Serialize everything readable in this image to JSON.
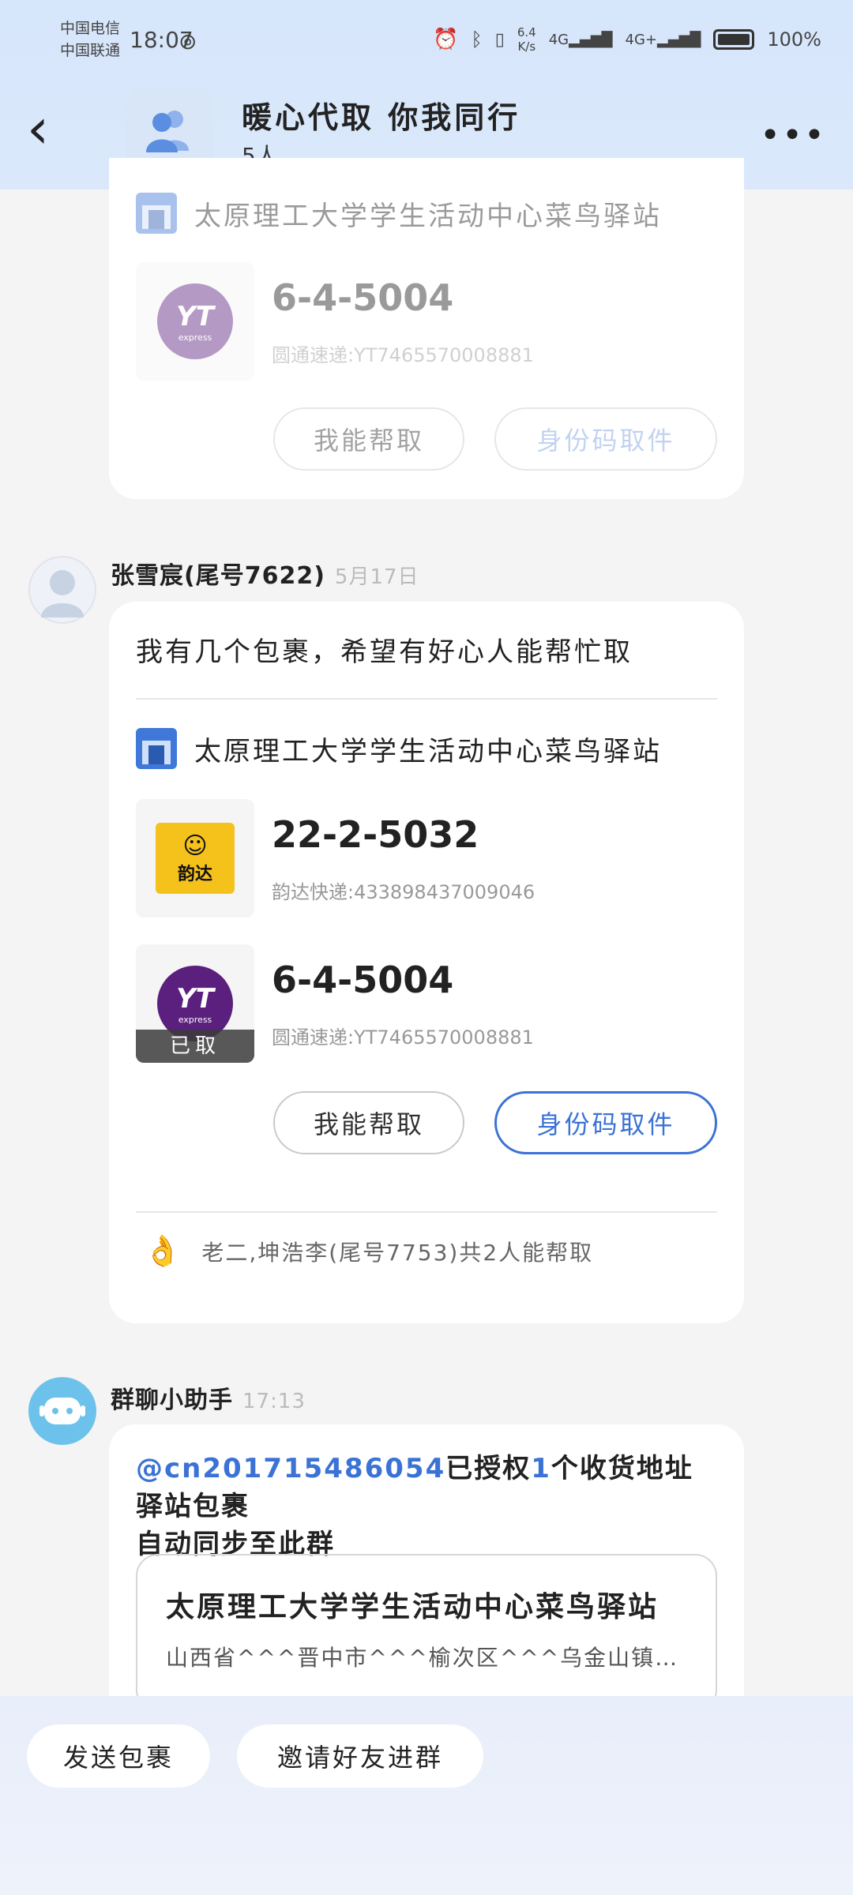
{
  "status_bar": {
    "carrier1": "中国电信",
    "carrier2": "中国联通",
    "time": "18:07",
    "speed_value": "6.4",
    "speed_unit": "K/s",
    "net1": "4G",
    "net2": "4G+",
    "battery": "100%"
  },
  "header": {
    "title": "暖心代取 你我同行",
    "member_count": "5人"
  },
  "message1": {
    "station": "太原理工大学学生活动中心菜鸟驿站",
    "package": {
      "code": "6-4-5004",
      "tracking": "圆通速递:YT7465570008881",
      "logo": "YTO express"
    },
    "help_button": "我能帮取",
    "id_button": "身份码取件"
  },
  "message2": {
    "sender": "张雪宸(尾号7622)",
    "time": "5月17日",
    "text": "我有几个包裹，希望有好心人能帮忙取",
    "station": "太原理工大学学生活动中心菜鸟驿站",
    "packages": [
      {
        "code": "22-2-5032",
        "tracking": "韵达快递:433898437009046",
        "logo": "韵达",
        "picked": ""
      },
      {
        "code": "6-4-5004",
        "tracking": "圆通速递:YT7465570008881",
        "logo": "YTO express",
        "picked": "已取"
      }
    ],
    "help_button": "我能帮取",
    "id_button": "身份码取件",
    "helpers_text": "老二,坤浩李(尾号7753)共2人能帮取"
  },
  "message3": {
    "sender": "群聊小助手",
    "time": "17:13",
    "mention": "@cn201715486054",
    "text_part1": "已授权",
    "text_count": "1",
    "text_part2": "个收货地址驿站包裹",
    "text_line2": "自动同步至此群",
    "station_name": "太原理工大学学生活动中心菜鸟驿站",
    "station_address": "山西省^^^晋中市^^^榆次区^^^乌金山镇…"
  },
  "bottom_bar": {
    "send_package": "发送包裹",
    "invite": "邀请好友进群"
  },
  "colors": {
    "accent": "#3b72d6",
    "header_bg": "#d6e6fb",
    "page_bg": "#f4f4f4"
  }
}
